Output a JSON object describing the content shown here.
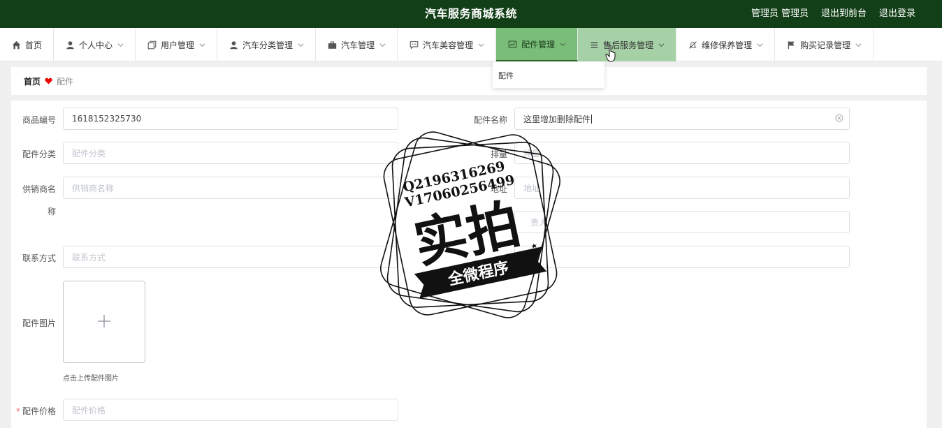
{
  "header": {
    "title": "汽车服务商城系统",
    "links": [
      "管理员 管理员",
      "退出到前台",
      "退出登录"
    ]
  },
  "nav": {
    "items": [
      {
        "label": "首页",
        "icon": "home-icon"
      },
      {
        "label": "个人中心",
        "icon": "user-icon"
      },
      {
        "label": "用户管理",
        "icon": "copy-icon"
      },
      {
        "label": "汽车分类管理",
        "icon": "user-icon"
      },
      {
        "label": "汽车管理",
        "icon": "briefcase-icon"
      },
      {
        "label": "汽车美容管理",
        "icon": "chat-icon"
      },
      {
        "label": "配件管理",
        "icon": "chart-icon"
      },
      {
        "label": "售后服务管理",
        "icon": "list-icon"
      },
      {
        "label": "维修保养管理",
        "icon": "bell-off-icon"
      },
      {
        "label": "购买记录管理",
        "icon": "flag-icon"
      }
    ],
    "active_index": 6,
    "hover_index": 7,
    "dropdown": {
      "items": [
        "配件"
      ]
    }
  },
  "breadcrumb": {
    "home": "首页",
    "current": "配件"
  },
  "form": {
    "product_no": {
      "label": "商品编号",
      "value": "1618152325730"
    },
    "part_name": {
      "label": "配件名称",
      "value": "这里增加删除配件"
    },
    "category": {
      "label": "配件分类",
      "placeholder": "配件分类"
    },
    "quantity": {
      "label": "排量",
      "placeholder": "排量"
    },
    "supplier": {
      "label_line1": "供销商名",
      "label_line2": "称",
      "placeholder": "供销商名称"
    },
    "address": {
      "label": "地址",
      "placeholder": "地址"
    },
    "person": {
      "placeholder": "责人"
    },
    "contact": {
      "label": "联系方式",
      "placeholder": "联系方式"
    },
    "extra": {
      "placeholder": "备"
    },
    "image": {
      "label": "配件图片",
      "hint": "点击上传配件图片"
    },
    "price": {
      "label": "配件价格",
      "placeholder": "配件价格"
    }
  },
  "watermark": {
    "line1": "Q2196316269",
    "line2": "V17060256499",
    "big": "实拍",
    "ribbon": "全微程序"
  },
  "colors": {
    "header_bg": "#123f17",
    "nav_active": "#79bd79",
    "nav_hover": "#a6d1a6",
    "required": "#f56c6c"
  }
}
